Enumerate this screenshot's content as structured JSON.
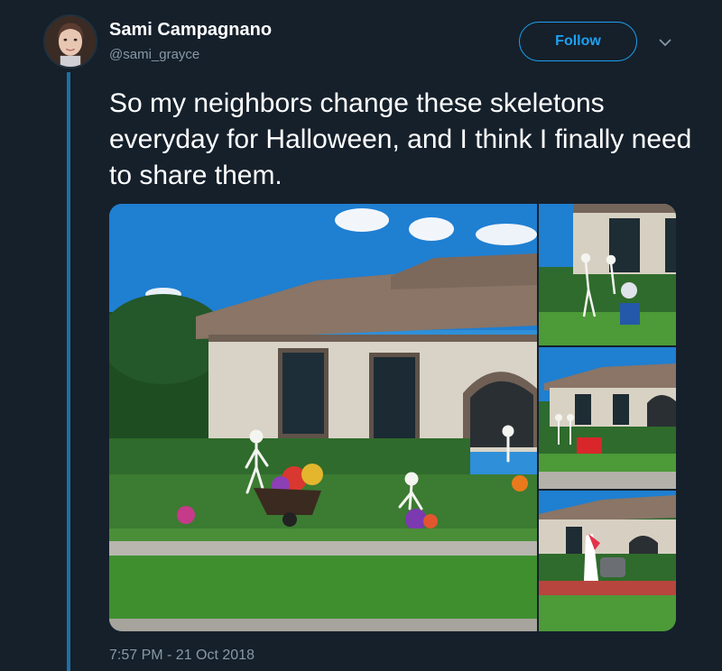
{
  "user": {
    "display_name": "Sami Campagnano",
    "handle": "@sami_grayce"
  },
  "actions": {
    "follow_label": "Follow"
  },
  "tweet": {
    "text": "So my neighbors change these skeletons everyday for Halloween, and I think I finally need to share them.",
    "timestamp": "7:57 PM - 21 Oct 2018"
  },
  "colors": {
    "background": "#15202b",
    "accent": "#1da1f2",
    "secondary_text": "#8899a6",
    "thread_line": "#1d6fa5"
  }
}
